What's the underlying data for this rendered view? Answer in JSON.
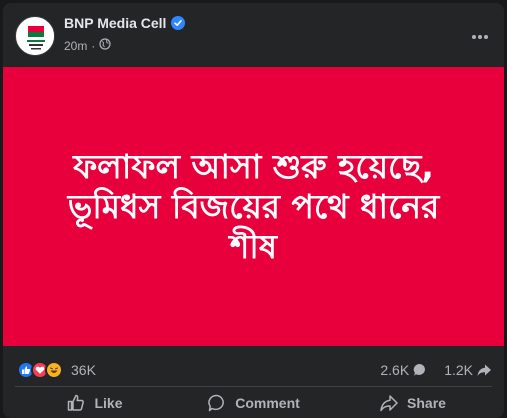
{
  "post": {
    "page_name": "BNP Media Cell",
    "timestamp": "20m",
    "audience": "globe-icon",
    "content_lines": [
      "ফলাফল আসা শুরু হয়েছে,",
      "ভূমিধস বিজয়ের পথে ধানের",
      "শীষ"
    ],
    "background_color": "#e8003c"
  },
  "stats": {
    "reactions_count": "36K",
    "comments_count": "2.6K",
    "shares_count": "1.2K",
    "reaction_icons": [
      "like-icon",
      "love-icon",
      "haha-icon"
    ]
  },
  "actions": {
    "like_label": "Like",
    "comment_label": "Comment",
    "share_label": "Share"
  }
}
